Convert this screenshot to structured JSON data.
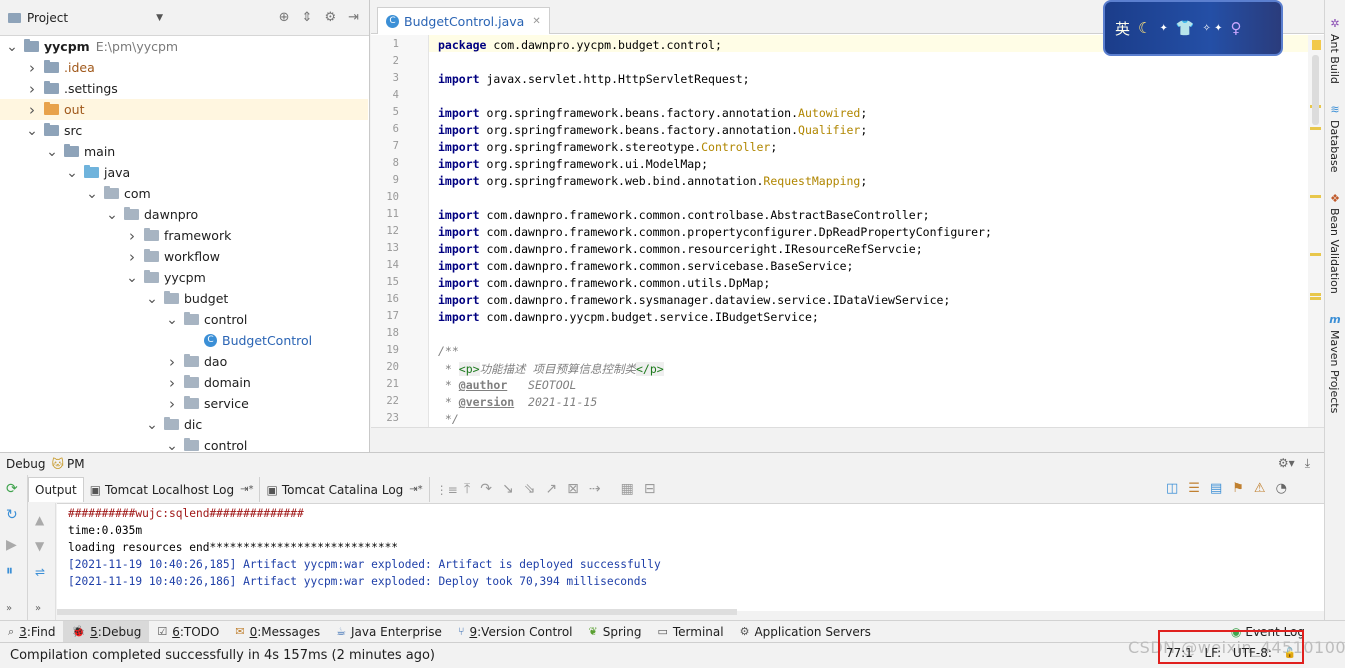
{
  "project_panel": {
    "title": "Project",
    "tree": [
      {
        "label": "yycpm",
        "path": "E:\\pm\\yycpm",
        "depth": 0,
        "arrow": "down",
        "icon": "folder",
        "style": "bold"
      },
      {
        "label": ".idea",
        "depth": 1,
        "arrow": "right",
        "icon": "folder",
        "style": "orange"
      },
      {
        "label": ".settings",
        "depth": 1,
        "arrow": "right",
        "icon": "folder",
        "style": "normal"
      },
      {
        "label": "out",
        "depth": 1,
        "arrow": "right",
        "icon": "folder-orange",
        "style": "orange",
        "selected": true
      },
      {
        "label": "src",
        "depth": 1,
        "arrow": "down",
        "icon": "folder",
        "style": "normal"
      },
      {
        "label": "main",
        "depth": 2,
        "arrow": "down",
        "icon": "folder",
        "style": "normal"
      },
      {
        "label": "java",
        "depth": 3,
        "arrow": "down",
        "icon": "folder-blue",
        "style": "normal"
      },
      {
        "label": "com",
        "depth": 4,
        "arrow": "down",
        "icon": "package",
        "style": "normal"
      },
      {
        "label": "dawnpro",
        "depth": 5,
        "arrow": "down",
        "icon": "package",
        "style": "normal"
      },
      {
        "label": "framework",
        "depth": 6,
        "arrow": "right",
        "icon": "package",
        "style": "normal"
      },
      {
        "label": "workflow",
        "depth": 6,
        "arrow": "right",
        "icon": "package",
        "style": "normal"
      },
      {
        "label": "yycpm",
        "depth": 6,
        "arrow": "down",
        "icon": "package",
        "style": "normal"
      },
      {
        "label": "budget",
        "depth": 7,
        "arrow": "down",
        "icon": "package",
        "style": "normal"
      },
      {
        "label": "control",
        "depth": 8,
        "arrow": "down",
        "icon": "package",
        "style": "normal"
      },
      {
        "label": "BudgetControl",
        "depth": 9,
        "arrow": "none",
        "icon": "class",
        "style": "blue"
      },
      {
        "label": "dao",
        "depth": 8,
        "arrow": "right",
        "icon": "package",
        "style": "normal"
      },
      {
        "label": "domain",
        "depth": 8,
        "arrow": "right",
        "icon": "package",
        "style": "normal"
      },
      {
        "label": "service",
        "depth": 8,
        "arrow": "right",
        "icon": "package",
        "style": "normal"
      },
      {
        "label": "dic",
        "depth": 7,
        "arrow": "down",
        "icon": "package",
        "style": "normal"
      },
      {
        "label": "control",
        "depth": 8,
        "arrow": "down",
        "icon": "package",
        "style": "normal"
      }
    ]
  },
  "editor": {
    "tab_label": "BudgetControl.java",
    "class_icon_letter": "C",
    "lines": [
      {
        "n": "1",
        "segs": [
          [
            "kw",
            "package"
          ],
          [
            "t",
            " com.dawnpro.yycpm.budget.control;"
          ]
        ]
      },
      {
        "n": "2",
        "segs": []
      },
      {
        "n": "3",
        "segs": [
          [
            "kw",
            "import"
          ],
          [
            "t",
            " javax.servlet.http.HttpServletRequest;"
          ]
        ]
      },
      {
        "n": "4",
        "segs": []
      },
      {
        "n": "5",
        "segs": [
          [
            "kw",
            "import"
          ],
          [
            "t",
            " org.springframework.beans.factory.annotation."
          ],
          [
            "an",
            "Autowired"
          ],
          [
            "t",
            ";"
          ]
        ]
      },
      {
        "n": "6",
        "segs": [
          [
            "kw",
            "import"
          ],
          [
            "t",
            " org.springframework.beans.factory.annotation."
          ],
          [
            "an",
            "Qualifier"
          ],
          [
            "t",
            ";"
          ]
        ]
      },
      {
        "n": "7",
        "segs": [
          [
            "kw",
            "import"
          ],
          [
            "t",
            " org.springframework.stereotype."
          ],
          [
            "an",
            "Controller"
          ],
          [
            "t",
            ";"
          ]
        ]
      },
      {
        "n": "8",
        "segs": [
          [
            "kw",
            "import"
          ],
          [
            "t",
            " org.springframework.ui.ModelMap;"
          ]
        ]
      },
      {
        "n": "9",
        "segs": [
          [
            "kw",
            "import"
          ],
          [
            "t",
            " org.springframework.web.bind.annotation."
          ],
          [
            "an",
            "RequestMapping"
          ],
          [
            "t",
            ";"
          ]
        ]
      },
      {
        "n": "10",
        "segs": []
      },
      {
        "n": "11",
        "segs": [
          [
            "kw",
            "import"
          ],
          [
            "t",
            " com.dawnpro.framework.common.controlbase.AbstractBaseController;"
          ]
        ]
      },
      {
        "n": "12",
        "segs": [
          [
            "kw",
            "import"
          ],
          [
            "t",
            " com.dawnpro.framework.common.propertyconfigurer.DpReadPropertyConfigurer;"
          ]
        ]
      },
      {
        "n": "13",
        "segs": [
          [
            "kw",
            "import"
          ],
          [
            "t",
            " com.dawnpro.framework.common.resourceright.IResourceRefServcie;"
          ]
        ]
      },
      {
        "n": "14",
        "segs": [
          [
            "kw",
            "import"
          ],
          [
            "t",
            " com.dawnpro.framework.common.servicebase.BaseService;"
          ]
        ]
      },
      {
        "n": "15",
        "segs": [
          [
            "kw",
            "import"
          ],
          [
            "t",
            " com.dawnpro.framework.common.utils.DpMap;"
          ]
        ]
      },
      {
        "n": "16",
        "segs": [
          [
            "kw",
            "import"
          ],
          [
            "t",
            " com.dawnpro.framework.sysmanager.dataview.service.IDataViewService;"
          ]
        ]
      },
      {
        "n": "17",
        "segs": [
          [
            "kw",
            "import"
          ],
          [
            "t",
            " com.dawnpro.yycpm.budget.service.IBudgetService;"
          ]
        ]
      },
      {
        "n": "18",
        "segs": []
      },
      {
        "n": "19",
        "segs": [
          [
            "cm",
            "/**"
          ]
        ]
      },
      {
        "n": "20",
        "segs": [
          [
            "cm",
            " * "
          ],
          [
            "tag",
            "<p>"
          ],
          [
            "cm",
            "功能描述 项目预算信息控制类"
          ],
          [
            "tag",
            "</p>"
          ]
        ]
      },
      {
        "n": "21",
        "segs": [
          [
            "cm",
            " * "
          ],
          [
            "doctag",
            "@author"
          ],
          [
            "cm",
            "   SEOTOOL"
          ]
        ]
      },
      {
        "n": "22",
        "segs": [
          [
            "cm",
            " * "
          ],
          [
            "doctag",
            "@version"
          ],
          [
            "cm",
            "  2021-11-15"
          ]
        ]
      },
      {
        "n": "23",
        "segs": [
          [
            "cm",
            " */"
          ]
        ]
      }
    ]
  },
  "ime_banner": {
    "text": "英"
  },
  "right_strip": [
    "Ant Build",
    "Database",
    "Bean Validation",
    "Maven Projects"
  ],
  "debug": {
    "title": "Debug",
    "config": "PM",
    "tabs": [
      "Output",
      "Tomcat Localhost Log",
      "Tomcat Catalina Log"
    ],
    "console": [
      {
        "text": "##########wujc:sqlend##############",
        "style": "red"
      },
      {
        "text": "time:0.035m",
        "style": "black"
      },
      {
        "text": "loading resources end****************************",
        "style": "black"
      },
      {
        "text": "[2021-11-19 10:40:26,185] Artifact yycpm:war exploded: Artifact is deployed successfully",
        "style": "blue"
      },
      {
        "text": "[2021-11-19 10:40:26,186] Artifact yycpm:war exploded: Deploy took 70,394 milliseconds",
        "style": "blue"
      }
    ]
  },
  "bottom_tools": [
    {
      "num": "3",
      "label": "Find",
      "icon": "search-icon"
    },
    {
      "num": "5",
      "label": "Debug",
      "icon": "bug-icon",
      "active": true
    },
    {
      "num": "6",
      "label": "TODO",
      "icon": "todo-icon"
    },
    {
      "num": "0",
      "label": "Messages",
      "icon": "messages-icon"
    },
    {
      "num": "",
      "label": "Java Enterprise",
      "icon": "java-enterprise-icon"
    },
    {
      "num": "9",
      "label": "Version Control",
      "icon": "version-control-icon"
    },
    {
      "num": "",
      "label": "Spring",
      "icon": "spring-icon"
    },
    {
      "num": "",
      "label": "Terminal",
      "icon": "terminal-icon"
    },
    {
      "num": "",
      "label": "Application Servers",
      "icon": "servers-icon"
    }
  ],
  "event_log": "Event Log",
  "status": {
    "message": "Compilation completed successfully in 4s 157ms (2 minutes ago)",
    "position": "77:1",
    "line_sep": "LF:",
    "encoding": "UTF-8:"
  },
  "watermark": "CSDN @weixin_44510100",
  "colors": {
    "highlight_box": "#e0201e",
    "selected_row": "#fff6e0",
    "keyword": "#000080",
    "annotation": "#b08600"
  }
}
